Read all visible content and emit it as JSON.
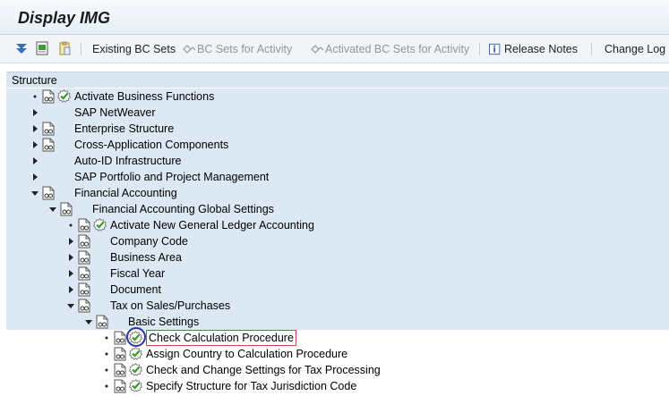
{
  "window": {
    "title": "Display IMG"
  },
  "toolbar": {
    "existing_bc_sets": "Existing BC Sets",
    "bc_sets_for_activity": "BC Sets for Activity",
    "activated_bc_sets": "Activated BC Sets for Activity",
    "release_notes": "Release Notes",
    "change_log": "Change Log"
  },
  "structure": {
    "header": "Structure",
    "rows": [
      {
        "label": "Activate Business Functions",
        "level": 0,
        "expander": "leaf",
        "doc": true,
        "check": true
      },
      {
        "label": "SAP NetWeaver",
        "level": 0,
        "expander": "collapsed",
        "doc": false,
        "check": false
      },
      {
        "label": "Enterprise Structure",
        "level": 0,
        "expander": "collapsed",
        "doc": true,
        "check": false
      },
      {
        "label": "Cross-Application Components",
        "level": 0,
        "expander": "collapsed",
        "doc": true,
        "check": false
      },
      {
        "label": "Auto-ID Infrastructure",
        "level": 0,
        "expander": "collapsed",
        "doc": false,
        "check": false
      },
      {
        "label": "SAP Portfolio and Project Management",
        "level": 0,
        "expander": "collapsed",
        "doc": false,
        "check": false
      },
      {
        "label": "Financial Accounting",
        "level": 0,
        "expander": "expanded",
        "doc": true,
        "check": false
      },
      {
        "label": "Financial Accounting Global Settings",
        "level": 1,
        "expander": "expanded",
        "doc": true,
        "check": false
      },
      {
        "label": "Activate New General Ledger Accounting",
        "level": 2,
        "expander": "leaf",
        "doc": true,
        "check": true
      },
      {
        "label": "Company Code",
        "level": 2,
        "expander": "collapsed",
        "doc": true,
        "check": false
      },
      {
        "label": "Business Area",
        "level": 2,
        "expander": "collapsed",
        "doc": true,
        "check": false
      },
      {
        "label": "Fiscal Year",
        "level": 2,
        "expander": "collapsed",
        "doc": true,
        "check": false
      },
      {
        "label": "Document",
        "level": 2,
        "expander": "collapsed",
        "doc": true,
        "check": false
      },
      {
        "label": "Tax on Sales/Purchases",
        "level": 2,
        "expander": "expanded",
        "doc": true,
        "check": false
      },
      {
        "label": "Basic Settings",
        "level": 3,
        "expander": "expanded",
        "doc": true,
        "check": false
      },
      {
        "label": "Check Calculation Procedure",
        "level": 4,
        "expander": "leaf",
        "doc": true,
        "check": true,
        "selected": true
      },
      {
        "label": "Assign Country to Calculation Procedure",
        "level": 4,
        "expander": "leaf",
        "doc": true,
        "check": true
      },
      {
        "label": "Check and Change Settings for Tax Processing",
        "level": 4,
        "expander": "leaf",
        "doc": true,
        "check": true
      },
      {
        "label": "Specify Structure for Tax Jurisdiction Code",
        "level": 4,
        "expander": "leaf",
        "doc": true,
        "check": true
      }
    ]
  },
  "colors": {
    "accent_check": "#3a9a2a",
    "highlight_circle": "#2136a8",
    "selection_border": "#c44a4a",
    "row_band": "#dce8f4"
  }
}
